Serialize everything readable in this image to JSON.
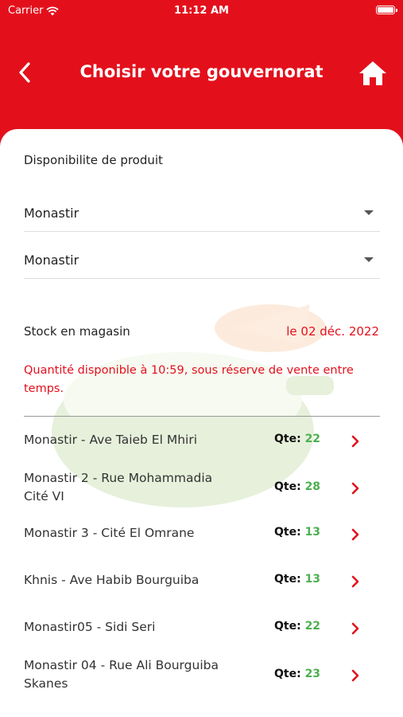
{
  "status_bar": {
    "carrier": "Carrier",
    "time": "11:12 AM"
  },
  "header": {
    "title": "Choisir votre gouvernorat",
    "back_icon": "chevron-left-icon",
    "home_icon": "home-icon"
  },
  "availability": {
    "label": "Disponibilite de produit",
    "selects": [
      {
        "value": "Monastir"
      },
      {
        "value": "Monastir"
      }
    ]
  },
  "stock": {
    "title": "Stock en magasin",
    "date": "le 02 déc. 2022",
    "note": "Quantité disponible à 10:59, sous réserve de vente entre temps."
  },
  "stores": [
    {
      "name": "Monastir - Ave Taieb El Mhiri",
      "qty_label": "Qte:",
      "qty": "22"
    },
    {
      "name": "Monastir 2 - Rue Mohammadia Cité VI",
      "qty_label": "Qte:",
      "qty": "28"
    },
    {
      "name": "Monastir 3 - Cité El Omrane",
      "qty_label": "Qte:",
      "qty": "13"
    },
    {
      "name": "Khnis - Ave Habib Bourguiba",
      "qty_label": "Qte:",
      "qty": "13"
    },
    {
      "name": "Monastir05 - Sidi Seri",
      "qty_label": "Qte:",
      "qty": "22"
    },
    {
      "name": "Monastir 04 - Rue Ali Bourguiba Skanes",
      "qty_label": "Qte:",
      "qty": "23"
    }
  ],
  "colors": {
    "primary": "#e3101c",
    "quantity": "#4caf50"
  }
}
